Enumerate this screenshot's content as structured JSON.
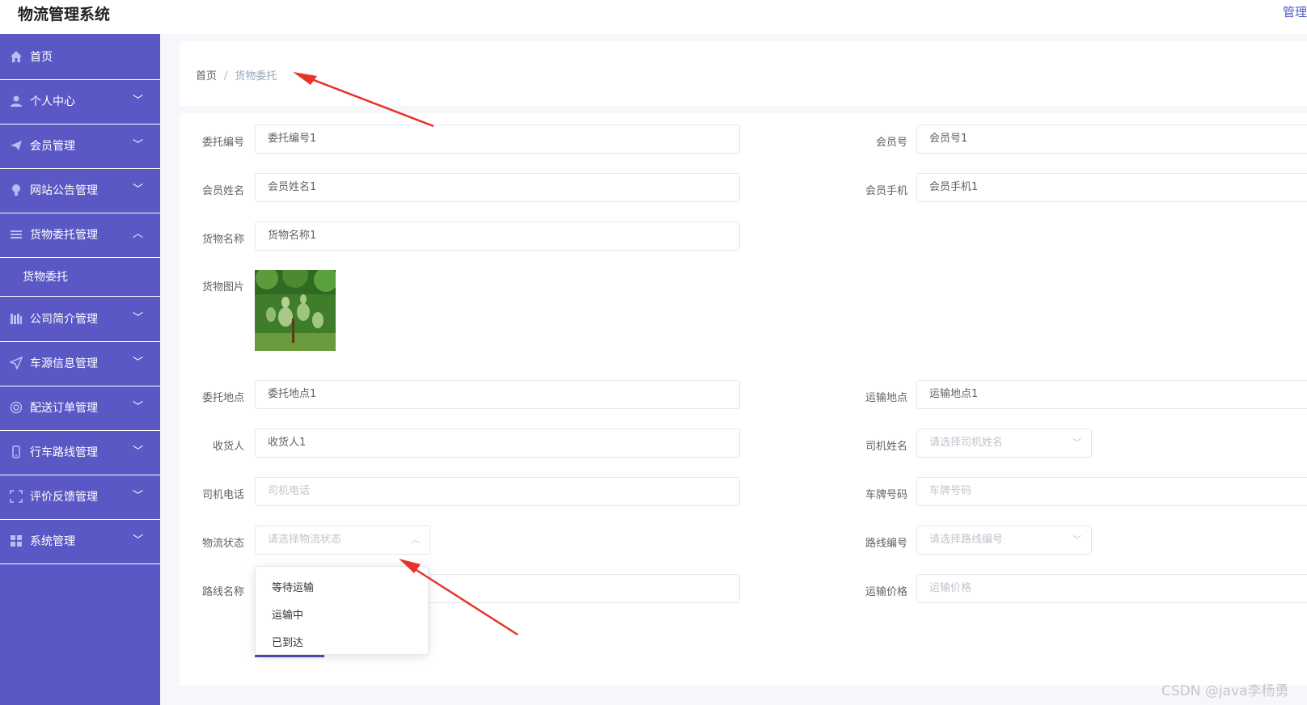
{
  "app": {
    "title": "物流管理系统",
    "top_right": "管理"
  },
  "sidebar": {
    "items": [
      {
        "label": "首页",
        "icon": "home-icon"
      },
      {
        "label": "个人中心",
        "icon": "user-icon"
      },
      {
        "label": "会员管理",
        "icon": "paper-plane-icon"
      },
      {
        "label": "网站公告管理",
        "icon": "lightbulb-icon"
      },
      {
        "label": "货物委托管理",
        "icon": "menu-lines-icon"
      },
      {
        "label": "公司简介管理",
        "icon": "books-icon"
      },
      {
        "label": "车源信息管理",
        "icon": "location-arrow-icon"
      },
      {
        "label": "配送订单管理",
        "icon": "lifebuoy-icon"
      },
      {
        "label": "行车路线管理",
        "icon": "phone-icon"
      },
      {
        "label": "评价反馈管理",
        "icon": "frame-icon"
      },
      {
        "label": "系统管理",
        "icon": "grid-icon"
      }
    ],
    "subitem": "货物委托"
  },
  "breadcrumb": {
    "home": "首页",
    "separator": "/",
    "current": "货物委托"
  },
  "form": {
    "weituo_bianhao": {
      "label": "委托编号",
      "value": "委托编号1"
    },
    "huiyuan_hao": {
      "label": "会员号",
      "value": "会员号1"
    },
    "huiyuan_xingming": {
      "label": "会员姓名",
      "value": "会员姓名1"
    },
    "huiyuan_shouji": {
      "label": "会员手机",
      "value": "会员手机1"
    },
    "huowu_mingcheng": {
      "label": "货物名称",
      "value": "货物名称1"
    },
    "huowu_tupian": {
      "label": "货物图片"
    },
    "weituo_didian": {
      "label": "委托地点",
      "value": "委托地点1"
    },
    "yunshu_didian": {
      "label": "运输地点",
      "value": "运输地点1"
    },
    "shouhuoren": {
      "label": "收货人",
      "value": "收货人1"
    },
    "siji_xingming": {
      "label": "司机姓名",
      "placeholder": "请选择司机姓名"
    },
    "siji_dianhua": {
      "label": "司机电话",
      "placeholder": "司机电话"
    },
    "chepai_haoma": {
      "label": "车牌号码",
      "placeholder": "车牌号码"
    },
    "wuliu_zhuangtai": {
      "label": "物流状态",
      "placeholder": "请选择物流状态"
    },
    "luxian_bianhao": {
      "label": "路线编号",
      "placeholder": "请选择路线编号"
    },
    "luxian_mingcheng": {
      "label": "路线名称"
    },
    "yunshu_jiage": {
      "label": "运输价格",
      "placeholder": "运输价格"
    }
  },
  "status_options": [
    "等待运输",
    "运输中",
    "已到达"
  ],
  "watermark": "CSDN @java李杨勇",
  "colors": {
    "sidebar": "#5a58c4",
    "accent": "#4f4dc0",
    "annotation_arrow": "#e8322b"
  }
}
